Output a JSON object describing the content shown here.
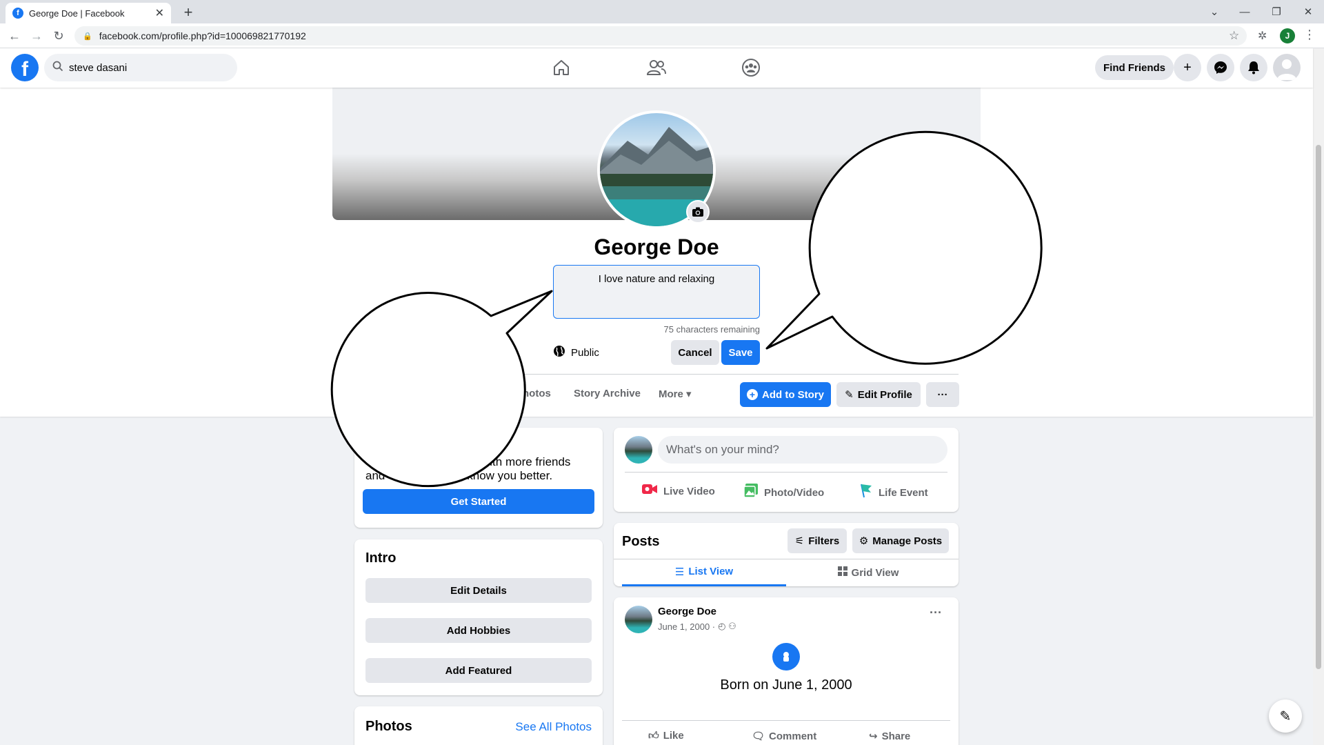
{
  "browser": {
    "tab_title": "George Doe | Facebook",
    "tab_close": "✕",
    "new_tab": "+",
    "url": "facebook.com/profile.php?id=100069821770192",
    "profile_initial": "J"
  },
  "nav": {
    "search_value": "steve dasani",
    "find_friends": "Find Friends"
  },
  "profile": {
    "name": "George Doe",
    "bio_value": "I love nature and relaxing",
    "chars_remaining": "75 characters remaining",
    "privacy": "Public",
    "cancel": "Cancel",
    "save": "Save"
  },
  "profile_tabs": {
    "photos": "hotos",
    "story_archive": "Story Archive",
    "more": "More ▾",
    "add_to_story": "Add to Story",
    "edit_profile": "Edit Profile",
    "more_options": "···"
  },
  "left_card": {
    "text_line1": "with more friends",
    "text_line2_a": "and",
    "text_line2_b": "to know you better.",
    "get_started": "Get Started"
  },
  "intro": {
    "title": "Intro",
    "edit_details": "Edit Details",
    "add_hobbies": "Add Hobbies",
    "add_featured": "Add Featured"
  },
  "photos": {
    "title": "Photos",
    "see_all": "See All Photos"
  },
  "composer": {
    "placeholder": "What's on your mind?",
    "live_video": "Live Video",
    "photo_video": "Photo/Video",
    "life_event": "Life Event"
  },
  "posts": {
    "title": "Posts",
    "filters": "Filters",
    "manage_posts": "Manage Posts",
    "list_view": "List View",
    "grid_view": "Grid View"
  },
  "post": {
    "author": "George Doe",
    "date": "June 1, 2000 ·",
    "event_text": "Born on June 1, 2000",
    "like": "Like",
    "comment": "Comment",
    "share": "Share",
    "options": "···"
  },
  "colors": {
    "brand": "#1877f2",
    "background": "#f0f2f5"
  },
  "icons": [
    "facebook-logo-icon",
    "search-icon",
    "home-icon",
    "friends-icon",
    "groups-icon",
    "plus-icon",
    "messenger-icon",
    "bell-icon",
    "camera-icon",
    "globe-icon",
    "live-video-icon",
    "photo-icon",
    "flag-icon",
    "filters-icon",
    "gear-icon",
    "list-icon",
    "grid-icon",
    "compose-icon"
  ]
}
